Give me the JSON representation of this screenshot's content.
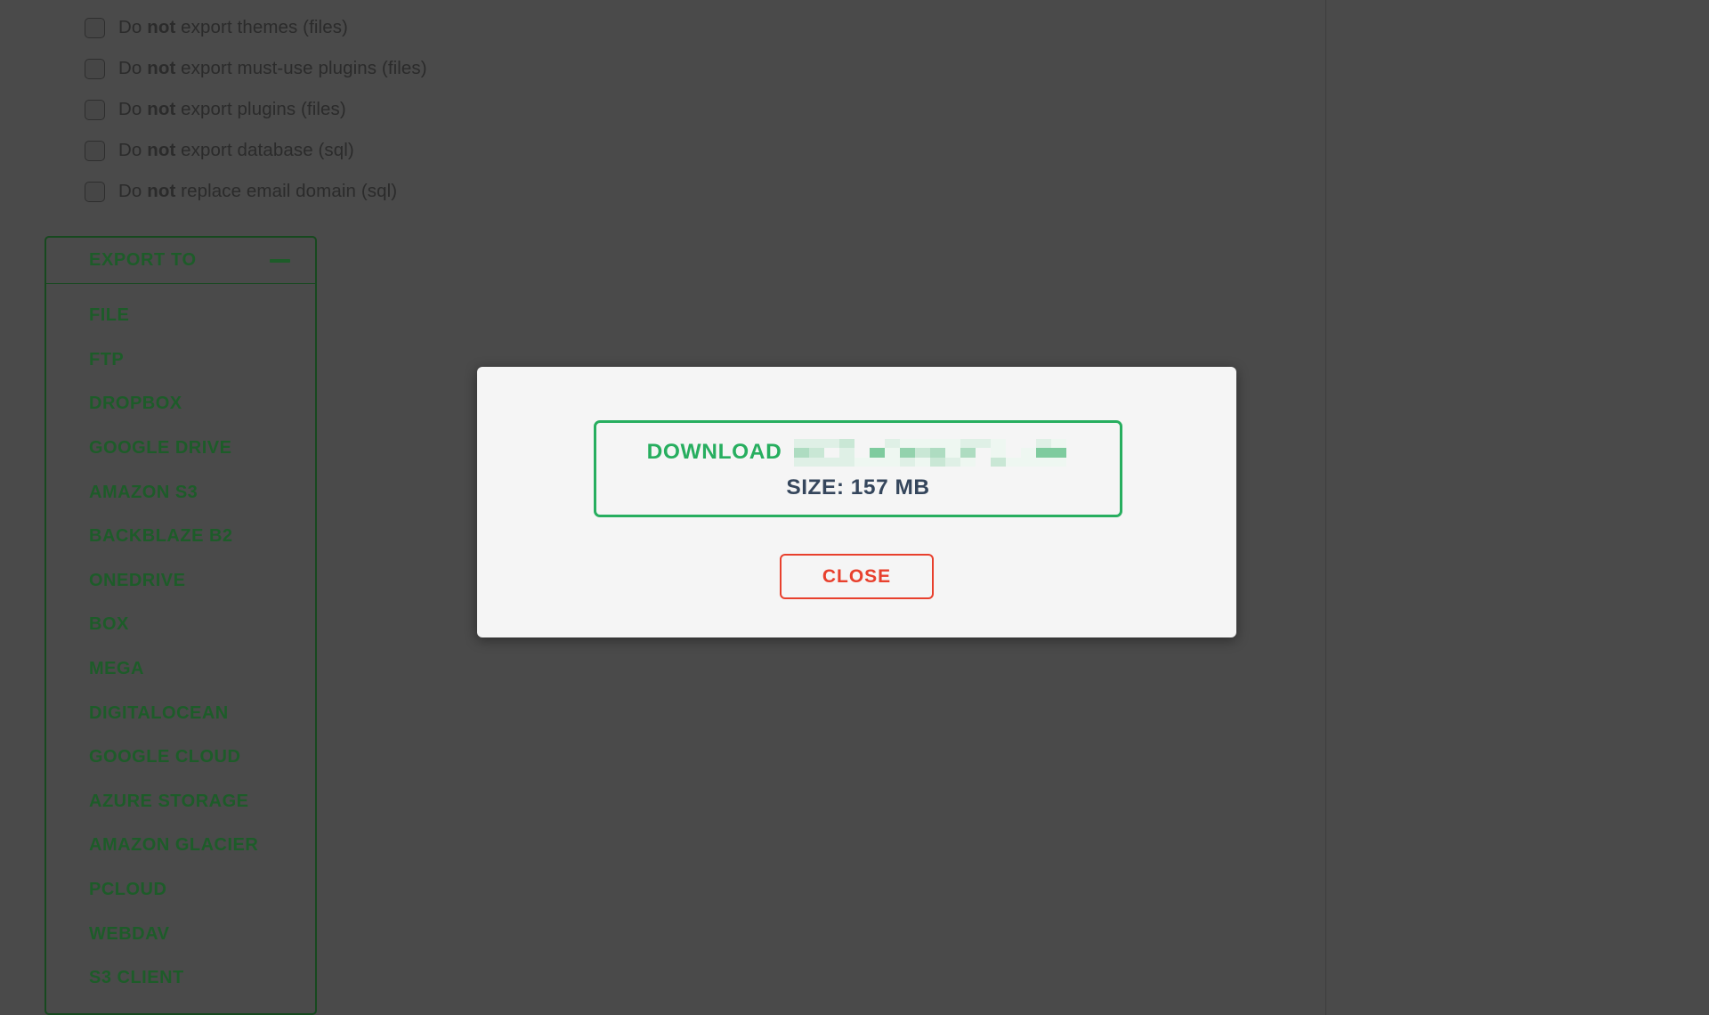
{
  "background": {
    "page_color": "#4a4a4a",
    "divider_color": "#3d3d3d"
  },
  "options": {
    "items": [
      {
        "prefix": "Do ",
        "emphasis": "not",
        "suffix": " export themes (files)",
        "checked": false
      },
      {
        "prefix": "Do ",
        "emphasis": "not",
        "suffix": " export must-use plugins (files)",
        "checked": false
      },
      {
        "prefix": "Do ",
        "emphasis": "not",
        "suffix": " export plugins (files)",
        "checked": false
      },
      {
        "prefix": "Do ",
        "emphasis": "not",
        "suffix": " export database (sql)",
        "checked": false
      },
      {
        "prefix": "Do ",
        "emphasis": "not",
        "suffix": " replace email domain (sql)",
        "checked": false
      }
    ]
  },
  "export_panel": {
    "title": "EXPORT TO",
    "collapse_icon": "minus-icon",
    "accent_color": "#1d5c29",
    "items": [
      {
        "label": "FILE"
      },
      {
        "label": "FTP"
      },
      {
        "label": "DROPBOX"
      },
      {
        "label": "GOOGLE DRIVE"
      },
      {
        "label": "AMAZON S3"
      },
      {
        "label": "BACKBLAZE B2"
      },
      {
        "label": "ONEDRIVE"
      },
      {
        "label": "BOX"
      },
      {
        "label": "MEGA"
      },
      {
        "label": "DIGITALOCEAN"
      },
      {
        "label": "GOOGLE CLOUD"
      },
      {
        "label": "AZURE STORAGE"
      },
      {
        "label": "AMAZON GLACIER"
      },
      {
        "label": "PCLOUD"
      },
      {
        "label": "WEBDAV"
      },
      {
        "label": "S3 CLIENT"
      }
    ]
  },
  "modal": {
    "download_label": "DOWNLOAD",
    "download_filename_redacted": true,
    "size_text": "SIZE: 157 MB",
    "close_label": "CLOSE",
    "download_accent_color": "#27ae5f",
    "size_color": "#35465c",
    "close_color": "#e8402d",
    "surface_color": "#f5f5f5"
  }
}
